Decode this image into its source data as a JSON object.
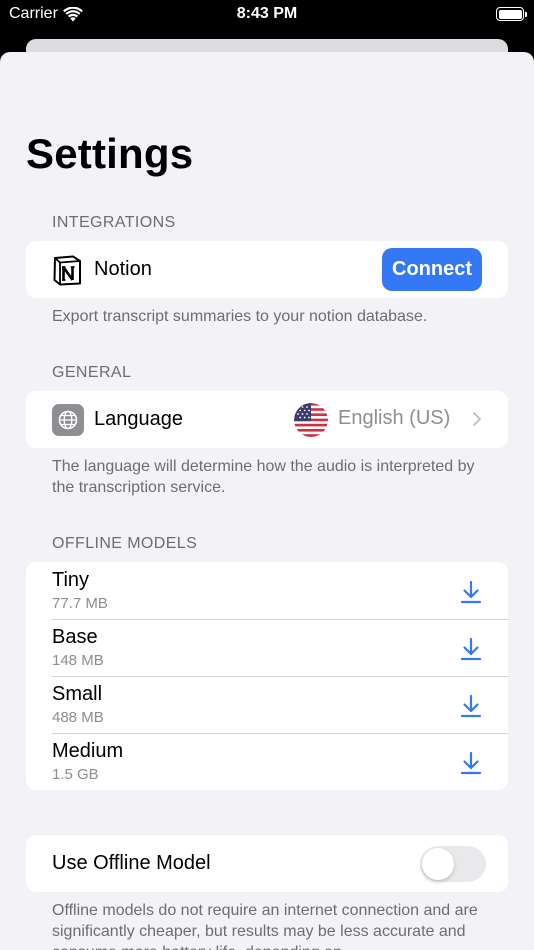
{
  "status_bar": {
    "carrier": "Carrier",
    "time": "8:43 PM"
  },
  "page": {
    "title": "Settings"
  },
  "integrations": {
    "header": "INTEGRATIONS",
    "notion": {
      "label": "Notion",
      "button": "Connect"
    },
    "footer": "Export transcript summaries to your notion database."
  },
  "general": {
    "header": "GENERAL",
    "language": {
      "label": "Language",
      "value": "English (US)"
    },
    "footer": "The language will determine how the audio is interpreted by the transcription service."
  },
  "offline_models": {
    "header": "OFFLINE MODELS",
    "models": [
      {
        "name": "Tiny",
        "size": "77.7 MB"
      },
      {
        "name": "Base",
        "size": "148 MB"
      },
      {
        "name": "Small",
        "size": "488 MB"
      },
      {
        "name": "Medium",
        "size": "1.5 GB"
      }
    ]
  },
  "use_offline": {
    "label": "Use Offline Model",
    "enabled": false,
    "footer": "Offline models do not require an internet connection and are significantly cheaper, but results may be less accurate and consume more battery life, depending on"
  },
  "colors": {
    "accent": "#3478f6",
    "background": "#f2f2f7",
    "secondary_text": "#6d6d72"
  },
  "icons": [
    "wifi-icon",
    "battery-icon",
    "notion-logo-icon",
    "globe-icon",
    "us-flag-icon",
    "chevron-right-icon",
    "download-icon"
  ]
}
